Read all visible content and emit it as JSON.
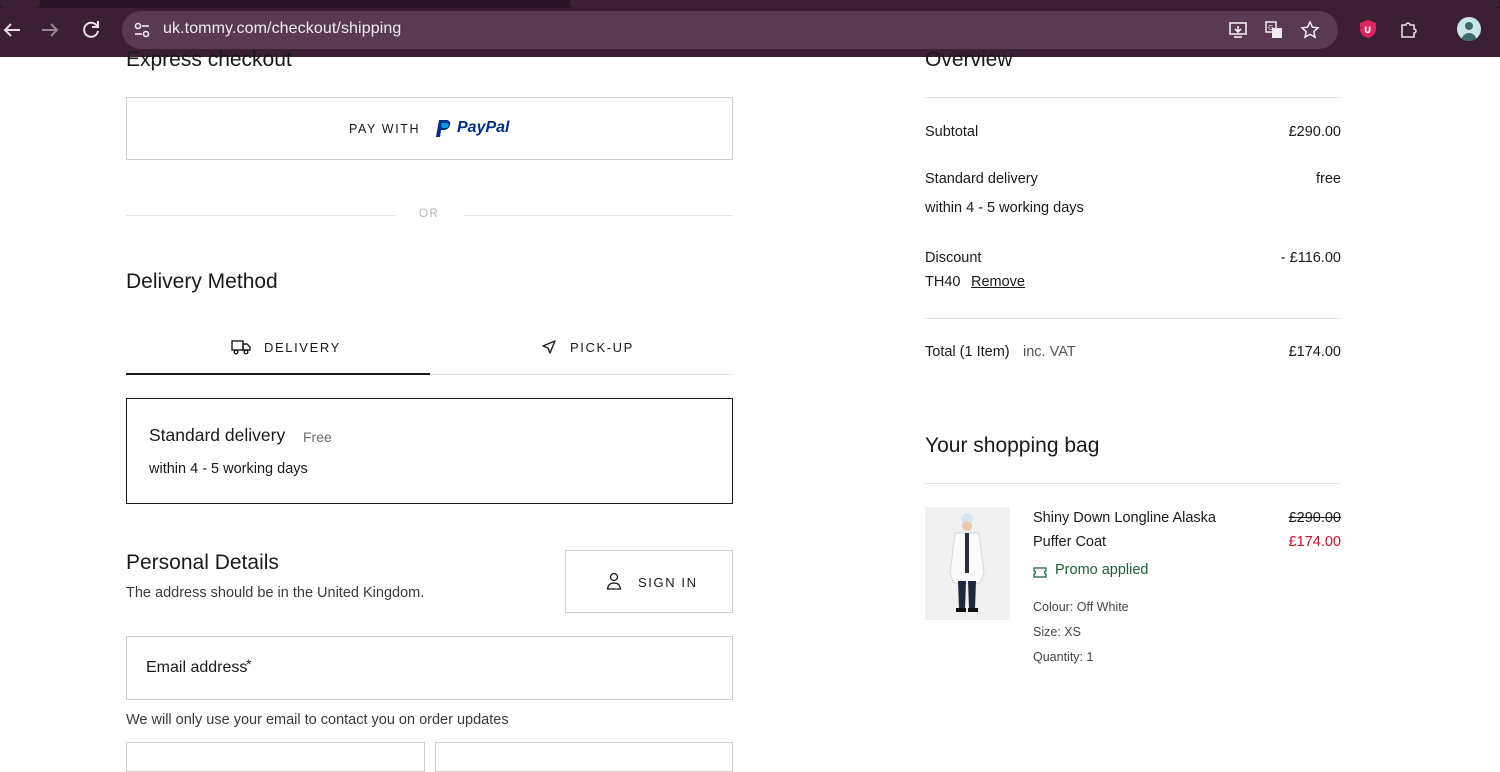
{
  "browser": {
    "url": "uk.tommy.com/checkout/shipping"
  },
  "express": {
    "title": "Express checkout",
    "pay_with": "PAY WITH",
    "paypal_logo": "PayPal",
    "or": "OR"
  },
  "delivery_method": {
    "title": "Delivery Method",
    "tabs": [
      {
        "label": "DELIVERY",
        "icon": "truck-icon",
        "active": true
      },
      {
        "label": "PICK-UP",
        "icon": "navigation-arrow-icon",
        "active": false
      }
    ],
    "option": {
      "name": "Standard delivery",
      "price": "Free",
      "time": "within 4 - 5 working days"
    }
  },
  "personal": {
    "title": "Personal Details",
    "subtitle": "The address should be in the United Kingdom.",
    "sign_in": "SIGN IN",
    "email_label": "Email address",
    "required_mark": "*",
    "email_note": "We will only use your email to contact you on order updates"
  },
  "overview": {
    "title": "Overview",
    "subtotal_label": "Subtotal",
    "subtotal_value": "£290.00",
    "delivery_label": "Standard delivery",
    "delivery_value": "free",
    "delivery_time": "within 4 - 5 working days",
    "discount_label": "Discount",
    "discount_value": "- £116.00",
    "discount_code": "TH40",
    "remove": "Remove",
    "total_label": "Total (1 Item)",
    "total_vat": "inc. VAT",
    "total_value": "£174.00"
  },
  "bag": {
    "title": "Your shopping bag",
    "items": [
      {
        "name_line1": "Shiny Down Longline Alaska",
        "name_line2": "Puffer Coat",
        "old_price": "£290.00",
        "new_price": "£174.00",
        "promo": "Promo applied",
        "colour": "Colour: Off White",
        "size": "Size: XS",
        "quantity": "Quantity: 1"
      }
    ]
  },
  "colors": {
    "accent_red": "#c8102e",
    "promo_green": "#1f5c3a",
    "chrome_bg": "#3c1f33"
  }
}
